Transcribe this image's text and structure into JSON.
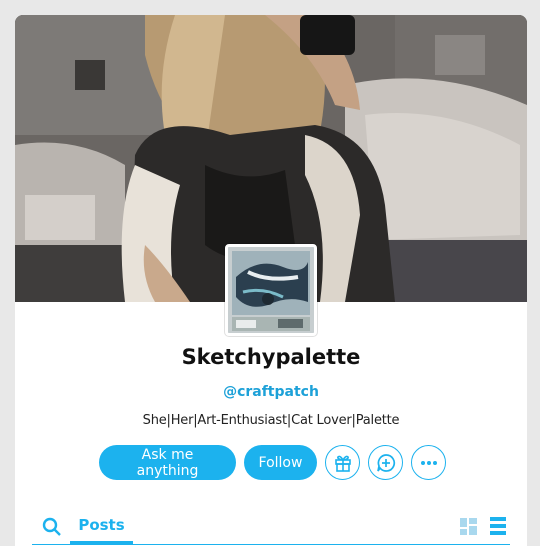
{
  "profile": {
    "name": "Sketchypalette",
    "handle": "@craftpatch",
    "bio": "She|Her|Art-Enthusiast|Cat Lover|Palette"
  },
  "actions": {
    "ask_label": "Ask me anything",
    "follow_label": "Follow"
  },
  "tabs": {
    "posts_label": "Posts"
  },
  "icons": {
    "gift": "gift-icon",
    "message": "message-plus-icon",
    "more": "more-icon",
    "search": "search-icon",
    "grid": "grid-view-icon",
    "list": "list-view-icon"
  },
  "colors": {
    "accent": "#1cb2ee",
    "background": "#e8e8e8"
  }
}
